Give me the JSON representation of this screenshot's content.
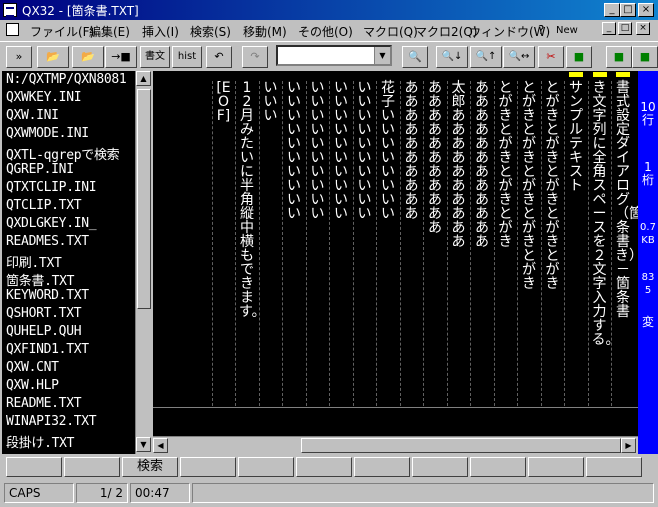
{
  "window": {
    "title": "QX32 - [箇条書.TXT]",
    "buttons": [
      "_",
      "□",
      "×"
    ]
  },
  "menu": {
    "items": [
      "ファイル(F)",
      "編集(E)",
      "挿入(I)",
      "検索(S)",
      "移動(M)",
      "その他(O)",
      "マクロ(Q)",
      "マクロ2(Q)",
      "ウィンドウ(W)",
      "?",
      "New"
    ],
    "mdi_buttons": [
      "_",
      "□",
      "×"
    ]
  },
  "toolbar": {
    "buttons": [
      "»",
      "📂",
      "📂",
      "→■",
      "書文",
      "hist",
      "↶",
      "↷",
      "🔍",
      "🔍↓",
      "🔍↑",
      "🔍↔",
      "✂",
      "■",
      "■",
      "■",
      "■"
    ],
    "combo_value": ""
  },
  "files": [
    "N:/QXTMP/QXN8081",
    "QXWKEY.INI",
    "QXW.INI",
    "QXWMODE.INI",
    "QXTL-qgrepで検索",
    "QGREP.INI",
    "QTXTCLIP.INI",
    "QTCLIP.TXT",
    "QXDLGKEY.IN_",
    "READMES.TXT",
    "印刷.TXT",
    "箇条書.TXT",
    "KEYWORD.TXT",
    "QSHORT.TXT",
    "QUHELP.QUH",
    "QXFIND1.TXT",
    "QXW.CNT",
    "QXW.HLP",
    "README.TXT",
    "WINAPI32.TXT",
    "段掛け.TXT"
  ],
  "editor": {
    "columns": [
      "書式設定ダイアログ（箇条書き）－箇条書",
      "き文字列に全角スペースを２文字入力する。",
      "サンプルテキスト",
      "とがきとがきとがきとがきとがき",
      "とがきとがきとがきとがきとがき",
      "とがきとがきとがきとがき",
      "ああああああああああああ",
      "太郎　ああああああああああ",
      "あああああああああああ",
      "ああああああああああ",
      "花子　いいいいいいいい",
      "いいいいいいいいいい",
      "いいいいいいいいいい",
      "いいいいいいいいいい",
      "いいいいいいいいいい",
      "いいい",
      "12月みたいに半角縦中横もできます。",
      "[EOF]"
    ]
  },
  "right_status": {
    "line": "10行",
    "col": "1桁",
    "size": "0.7KB",
    "info": "835",
    "mode": "変"
  },
  "fkeys": [
    "",
    "",
    "検索",
    "",
    "",
    "",
    "",
    "",
    "",
    "",
    ""
  ],
  "status": {
    "caps": "CAPS",
    "page": "1/ 2",
    "time": "00:47"
  }
}
